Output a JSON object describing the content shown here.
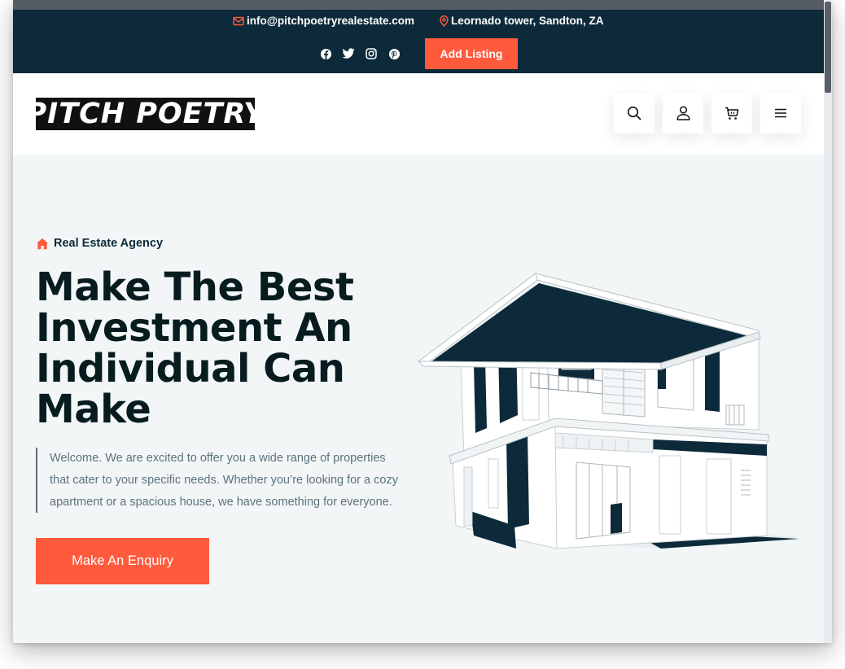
{
  "topbar": {
    "email": "info@pitchpoetryrealestate.com",
    "address": "Leornado tower, Sandton, ZA",
    "add_listing_label": "Add Listing",
    "socials": [
      "facebook-icon",
      "twitter-icon",
      "instagram-icon",
      "pinterest-icon"
    ]
  },
  "header": {
    "logo_text": "PITCH POETRY",
    "actions": [
      "search-icon",
      "user-icon",
      "cart-icon",
      "menu-icon"
    ]
  },
  "hero": {
    "eyebrow": "Real Estate Agency",
    "headline_lines": [
      "Make The Best",
      "Investment An",
      "Individual Can",
      "Make"
    ],
    "welcome_lines": [
      "Welcome. We are excited to offer you a wide range of properties",
      "that cater to your specific needs. Whether you’re looking for a cozy",
      "apartment or a spacious house, we have something for everyone."
    ],
    "cta_label": "Make An Enquiry"
  },
  "colors": {
    "navy": "#0d2a3a",
    "accent": "#ff5a3c",
    "hero_bg": "#f2f6f7",
    "heading": "#071c1f",
    "body_text": "#5c727d"
  }
}
